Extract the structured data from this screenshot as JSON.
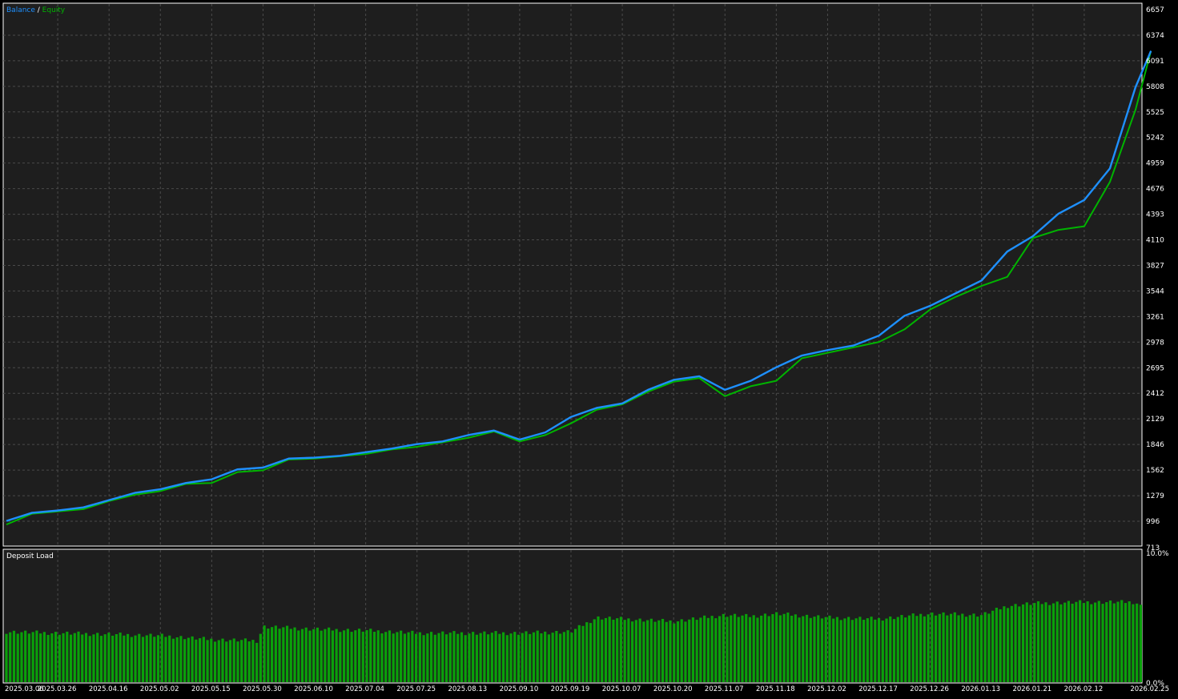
{
  "legend": {
    "balance_label": "Balance",
    "separator": " / ",
    "equity_label": "Equity"
  },
  "colors": {
    "background": "#000000",
    "plot_background": "#1e1e1e",
    "grid": "#4a4a4a",
    "balance": "#1e90ff",
    "equity": "#00b400",
    "text": "#ffffff",
    "deposit_bar": "#0aa00a"
  },
  "chart_data": [
    {
      "type": "line",
      "title": "",
      "legend_position": "top-left",
      "grid": true,
      "ylim": [
        713,
        6657
      ],
      "y_ticks": [
        "6657",
        "6374",
        "6091",
        "5808",
        "5525",
        "5242",
        "4959",
        "4676",
        "4393",
        "4110",
        "3827",
        "3544",
        "3261",
        "2978",
        "2695",
        "2412",
        "2129",
        "1846",
        "1562",
        "1279",
        "996",
        "713"
      ],
      "x_ticks": [
        "2025.03.06",
        "2025.03.26",
        "2025.04.16",
        "2025.05.02",
        "2025.05.15",
        "2025.05.30",
        "2025.06.10",
        "2025.07.04",
        "2025.07.25",
        "2025.08.13",
        "2025.09.10",
        "2025.09.19",
        "2025.10.07",
        "2025.10.20",
        "2025.11.07",
        "2025.11.18",
        "2025.12.02",
        "2025.12.17",
        "2025.12.26",
        "2026.01.13",
        "2026.01.21",
        "2026.02.12",
        "2026.02.25"
      ],
      "series": [
        {
          "name": "Balance",
          "x": [
            0,
            0.5,
            1,
            1.5,
            2,
            2.5,
            3,
            3.5,
            4,
            4.5,
            5,
            5.5,
            6,
            6.5,
            7,
            7.5,
            8,
            8.5,
            9,
            9.5,
            10,
            10.5,
            11,
            11.5,
            12,
            12.5,
            13,
            13.5,
            14,
            14.5,
            15,
            15.5,
            16,
            16.5,
            17,
            17.5,
            18,
            18.5,
            19,
            19.5,
            20,
            20.5,
            21,
            21.5,
            22,
            22.3
          ],
          "values": [
            1000,
            1090,
            1115,
            1150,
            1230,
            1310,
            1350,
            1420,
            1460,
            1570,
            1590,
            1690,
            1700,
            1720,
            1760,
            1800,
            1850,
            1880,
            1950,
            2000,
            1900,
            1980,
            2150,
            2250,
            2300,
            2450,
            2560,
            2600,
            2450,
            2550,
            2700,
            2830,
            2890,
            2940,
            3050,
            3270,
            3380,
            3520,
            3660,
            3980,
            4150,
            4400,
            4550,
            4900,
            5800,
            6200
          ]
        },
        {
          "name": "Equity",
          "x": [
            0,
            0.5,
            1,
            1.5,
            2,
            2.5,
            3,
            3.5,
            4,
            4.5,
            5,
            5.5,
            6,
            6.5,
            7,
            7.5,
            8,
            8.5,
            9,
            9.5,
            10,
            10.5,
            11,
            11.5,
            12,
            12.5,
            13,
            13.5,
            14,
            14.5,
            15,
            15.5,
            16,
            16.5,
            17,
            17.5,
            18,
            18.5,
            19,
            19.5,
            20,
            20.5,
            21,
            21.5,
            22,
            22.3
          ],
          "values": [
            960,
            1080,
            1105,
            1130,
            1220,
            1290,
            1330,
            1410,
            1420,
            1540,
            1560,
            1680,
            1690,
            1715,
            1740,
            1790,
            1820,
            1870,
            1920,
            1990,
            1880,
            1950,
            2080,
            2230,
            2290,
            2430,
            2540,
            2580,
            2380,
            2490,
            2550,
            2800,
            2860,
            2920,
            2980,
            3120,
            3340,
            3480,
            3600,
            3700,
            4130,
            4220,
            4260,
            4750,
            5550,
            6200
          ]
        }
      ]
    },
    {
      "type": "bar",
      "title": "Deposit Load",
      "ylim": [
        0,
        10
      ],
      "y_ticks": [
        "10.0%",
        "0.0%"
      ],
      "series": [
        {
          "name": "Deposit Load",
          "x": [
            0,
            1,
            2,
            3,
            4,
            4.9,
            5,
            6,
            7,
            8,
            9,
            10,
            11,
            11.5,
            12,
            13,
            14,
            14.5,
            15,
            16,
            17,
            18,
            19,
            19.5,
            20,
            21,
            22,
            22.1
          ],
          "values": [
            3.9,
            3.8,
            3.7,
            3.6,
            3.3,
            3.2,
            4.3,
            4.1,
            4.0,
            3.8,
            3.8,
            3.8,
            3.9,
            5.0,
            4.9,
            4.7,
            5.2,
            5.1,
            5.3,
            5.0,
            4.9,
            5.3,
            5.2,
            5.9,
            6.1,
            6.2,
            6.2,
            5.9
          ]
        }
      ]
    }
  ]
}
